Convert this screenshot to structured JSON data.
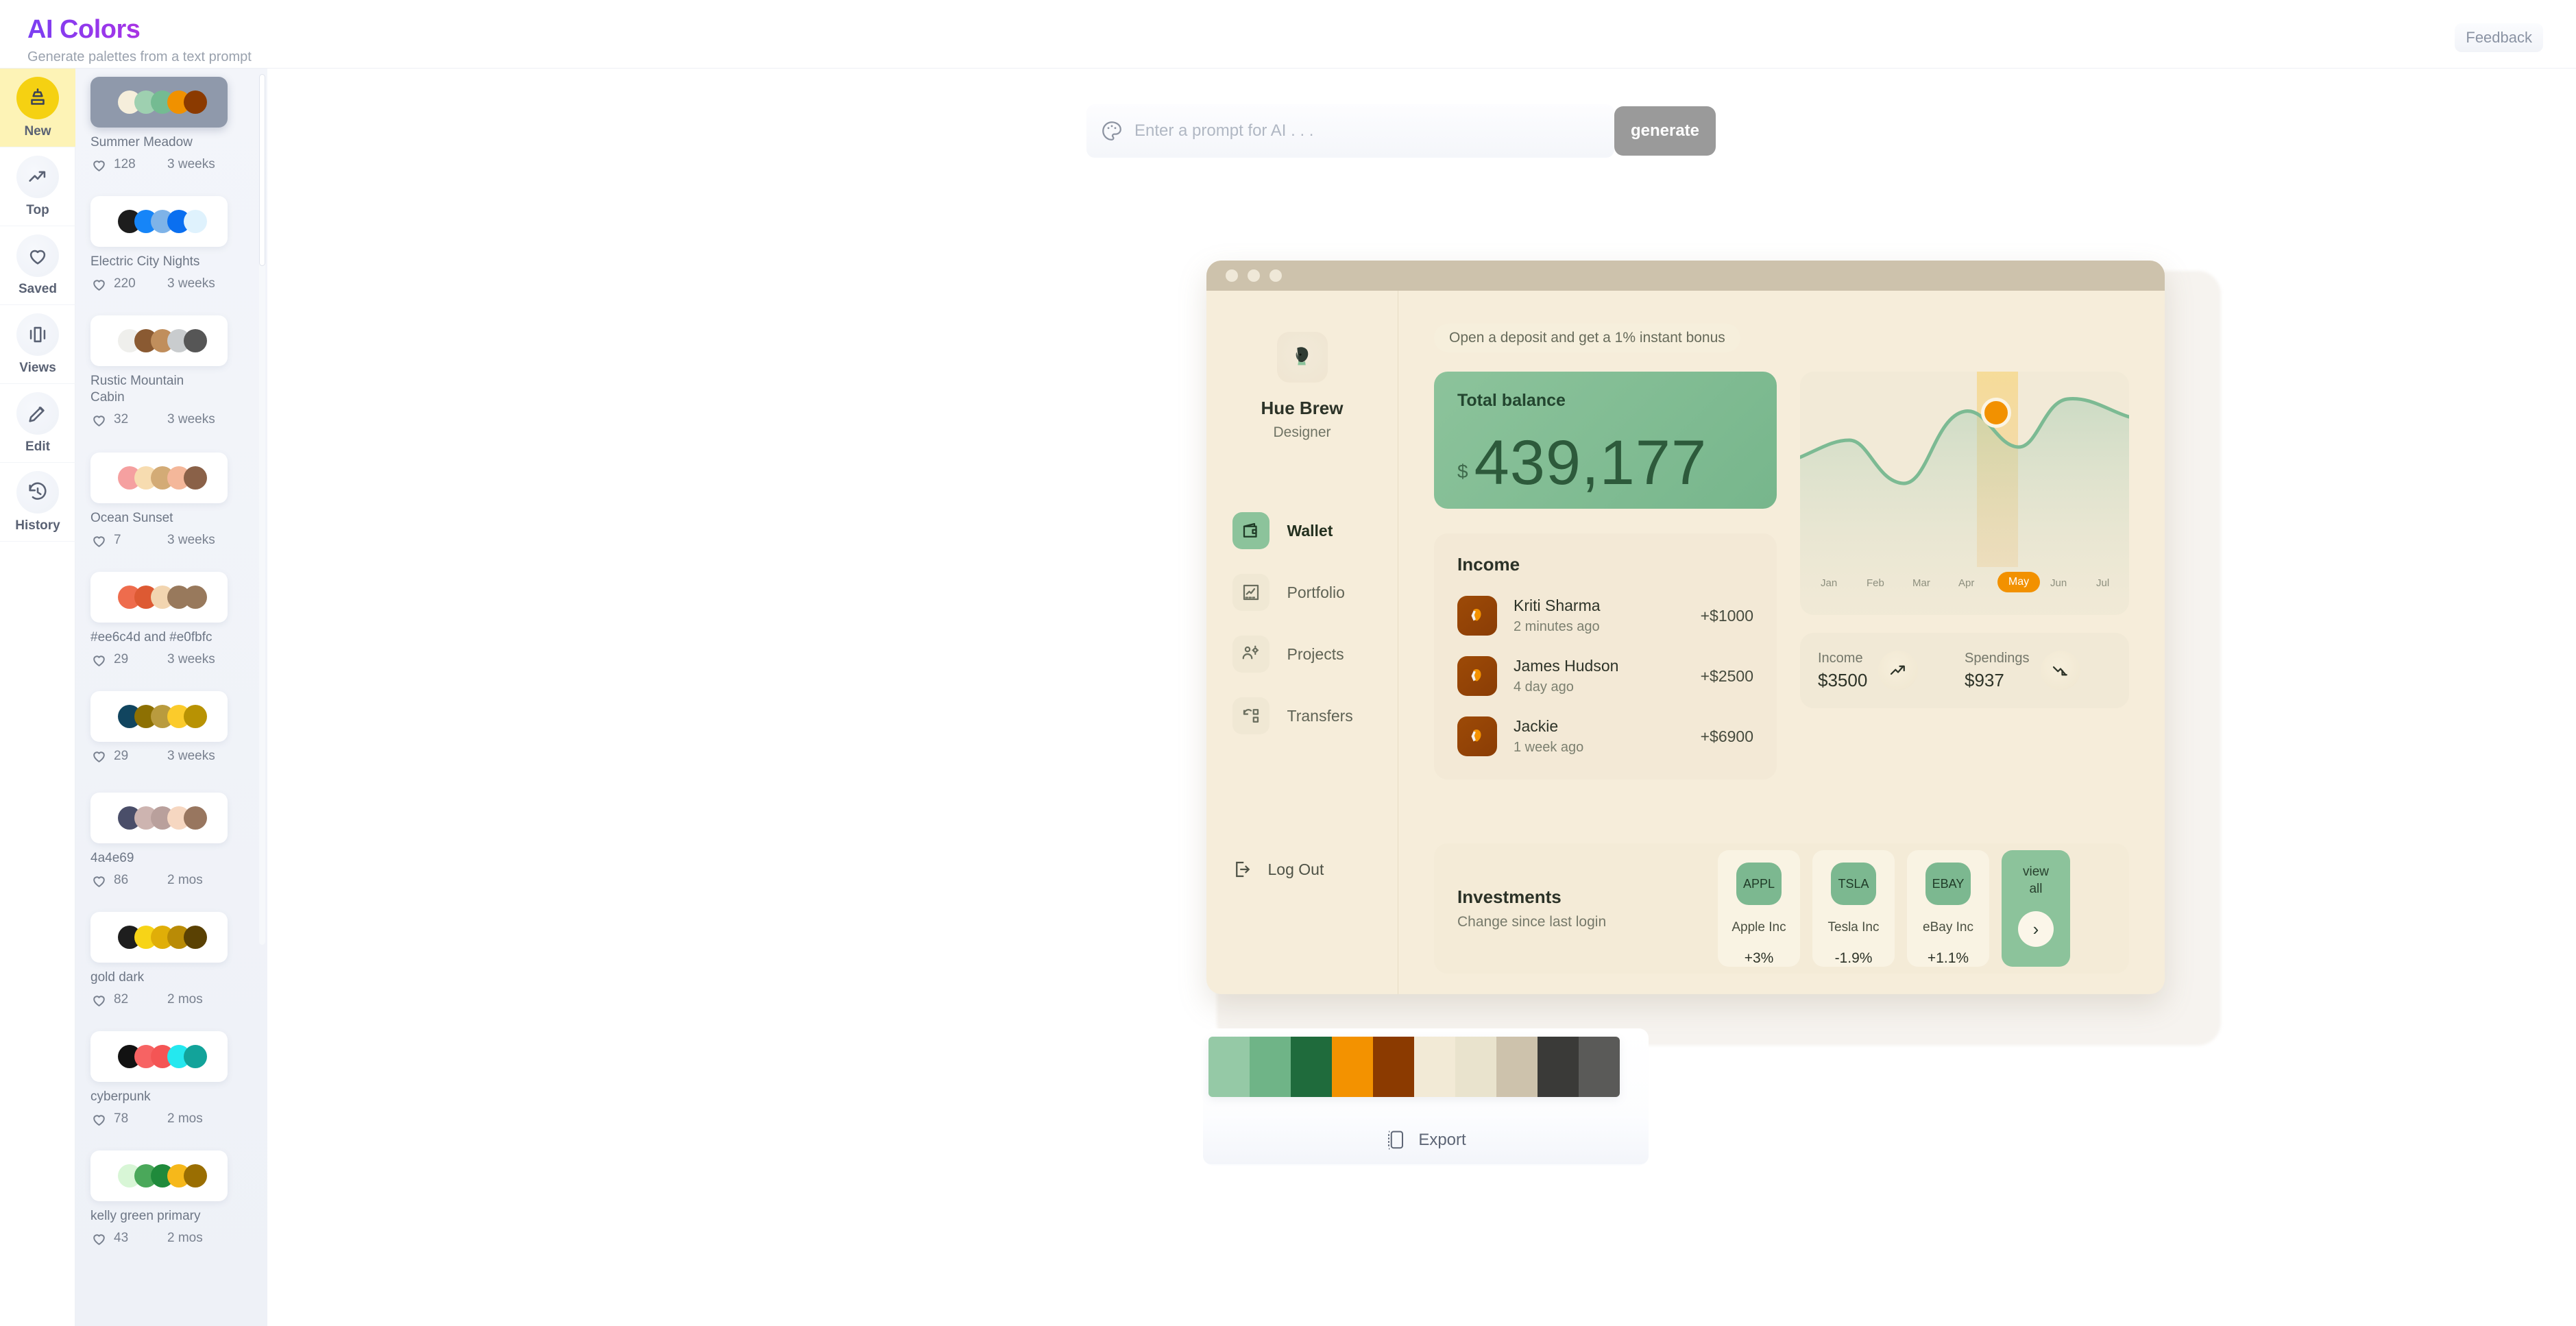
{
  "header": {
    "brand_title": "AI Colors",
    "brand_subtitle": "Generate palettes from a text prompt",
    "feedback_label": "Feedback"
  },
  "rail": {
    "items": [
      {
        "label": "New",
        "icon": "stamp-icon",
        "active": true
      },
      {
        "label": "Top",
        "icon": "trending-up-icon",
        "active": false
      },
      {
        "label": "Saved",
        "icon": "heart-icon",
        "active": false
      },
      {
        "label": "Views",
        "icon": "carousel-icon",
        "active": false
      },
      {
        "label": "Edit",
        "icon": "pencil-icon",
        "active": false
      },
      {
        "label": "History",
        "icon": "history-icon",
        "active": false
      }
    ]
  },
  "palette_list": {
    "items": [
      {
        "name": "Summer Meadow",
        "likes": "128",
        "age": "3 weeks",
        "selected": true,
        "colors": [
          "#f5eedb",
          "#9ed0b0",
          "#74bb92",
          "#f09100",
          "#8b3a00"
        ]
      },
      {
        "name": "Electric City Nights",
        "likes": "220",
        "age": "3 weeks",
        "selected": false,
        "colors": [
          "#1d1d1d",
          "#1685f8",
          "#7eb3e8",
          "#0a6ff0",
          "#dff2fd"
        ]
      },
      {
        "name": "Rustic Mountain Cabin",
        "likes": "32",
        "age": "3 weeks",
        "selected": false,
        "colors": [
          "#efefec",
          "#8a5a32",
          "#c08e5c",
          "#c9ccce",
          "#565656"
        ]
      },
      {
        "name": "Ocean Sunset",
        "likes": "7",
        "age": "3 weeks",
        "selected": false,
        "colors": [
          "#f5a0a0",
          "#f7dcb0",
          "#d3ab76",
          "#f4b79a",
          "#8a6148"
        ]
      },
      {
        "name": "#ee6c4d and #e0fbfc",
        "likes": "29",
        "age": "3 weeks",
        "selected": false,
        "colors": [
          "#ee6c4d",
          "#dd5a33",
          "#f2d5b0",
          "#98795c",
          "#98795c"
        ]
      },
      {
        "name": "",
        "likes": "29",
        "age": "3 weeks",
        "selected": false,
        "colors": [
          "#11455f",
          "#8d7003",
          "#b99b3e",
          "#fbcb2b",
          "#b89203"
        ]
      },
      {
        "name": "4a4e69",
        "likes": "86",
        "age": "2 mos",
        "selected": false,
        "colors": [
          "#4a4e69",
          "#cdb4b0",
          "#b9a09c",
          "#f6d7c1",
          "#98765f"
        ]
      },
      {
        "name": "gold dark",
        "likes": "82",
        "age": "2 mos",
        "selected": false,
        "colors": [
          "#1e1e1e",
          "#f7d417",
          "#e0ae08",
          "#b98b06",
          "#5a4103"
        ]
      },
      {
        "name": "cyberpunk",
        "likes": "78",
        "age": "2 mos",
        "selected": false,
        "colors": [
          "#121212",
          "#f76363",
          "#f45555",
          "#24e8ef",
          "#12a39a"
        ]
      },
      {
        "name": "kelly green primary",
        "likes": "43",
        "age": "2 mos",
        "selected": false,
        "colors": [
          "#d8f6d6",
          "#4aa85a",
          "#1f8a3b",
          "#f6b81a",
          "#9a6e02"
        ]
      }
    ]
  },
  "prompt": {
    "placeholder": "Enter a prompt for AI . . .",
    "value": "",
    "generate_label": "generate"
  },
  "mockup": {
    "user": {
      "name": "Hue Brew",
      "role": "Designer"
    },
    "nav": [
      {
        "label": "Wallet",
        "icon": "wallet-icon",
        "active": true
      },
      {
        "label": "Portfolio",
        "icon": "chart-box-icon",
        "active": false
      },
      {
        "label": "Projects",
        "icon": "user-gear-icon",
        "active": false
      },
      {
        "label": "Transfers",
        "icon": "transfer-icon",
        "active": false
      }
    ],
    "logout_label": "Log Out",
    "deposit_banner": "Open a deposit and get a 1% instant bonus",
    "balance": {
      "label": "Total balance",
      "currency": "$",
      "amount": "439,177"
    },
    "income": {
      "title": "Income",
      "rows": [
        {
          "name": "Kriti Sharma",
          "time": "2 minutes ago",
          "amount": "+$1000"
        },
        {
          "name": "James Hudson",
          "time": "4 day ago",
          "amount": "+$2500"
        },
        {
          "name": "Jackie",
          "time": "1 week ago",
          "amount": "+$6900"
        }
      ]
    },
    "stats": [
      {
        "label": "Income",
        "value": "$3500",
        "trend": "up"
      },
      {
        "label": "Spendings",
        "value": "$937",
        "trend": "down"
      }
    ],
    "investments": {
      "title": "Investments",
      "subtitle": "Change since last login",
      "items": [
        {
          "ticker": "APPL",
          "name": "Apple Inc",
          "change": "+3%"
        },
        {
          "ticker": "TSLA",
          "name": "Tesla Inc",
          "change": "-1.9%"
        },
        {
          "ticker": "EBAY",
          "name": "eBay Inc",
          "change": "+1.1%"
        }
      ],
      "view_all_label": "view all"
    }
  },
  "chart_data": {
    "type": "area",
    "title": "",
    "xlabel": "",
    "ylabel": "",
    "categories": [
      "Jan",
      "Feb",
      "Mar",
      "Apr",
      "May",
      "Jun",
      "Jul"
    ],
    "values": [
      58,
      66,
      38,
      40,
      88,
      56,
      92
    ],
    "ylim": [
      0,
      100
    ],
    "highlight_category": "May",
    "line_color": "#7cba93",
    "marker_color": "#f29100",
    "grid": false,
    "legend": "none"
  },
  "export": {
    "label": "Export",
    "strip_colors": [
      "#95c9a6",
      "#6fb487",
      "#1f6b3c",
      "#f39200",
      "#8b3a00",
      "#f2ead6",
      "#e9e3cd",
      "#cdc2ac",
      "#3a3a38",
      "#5a5a58"
    ]
  }
}
